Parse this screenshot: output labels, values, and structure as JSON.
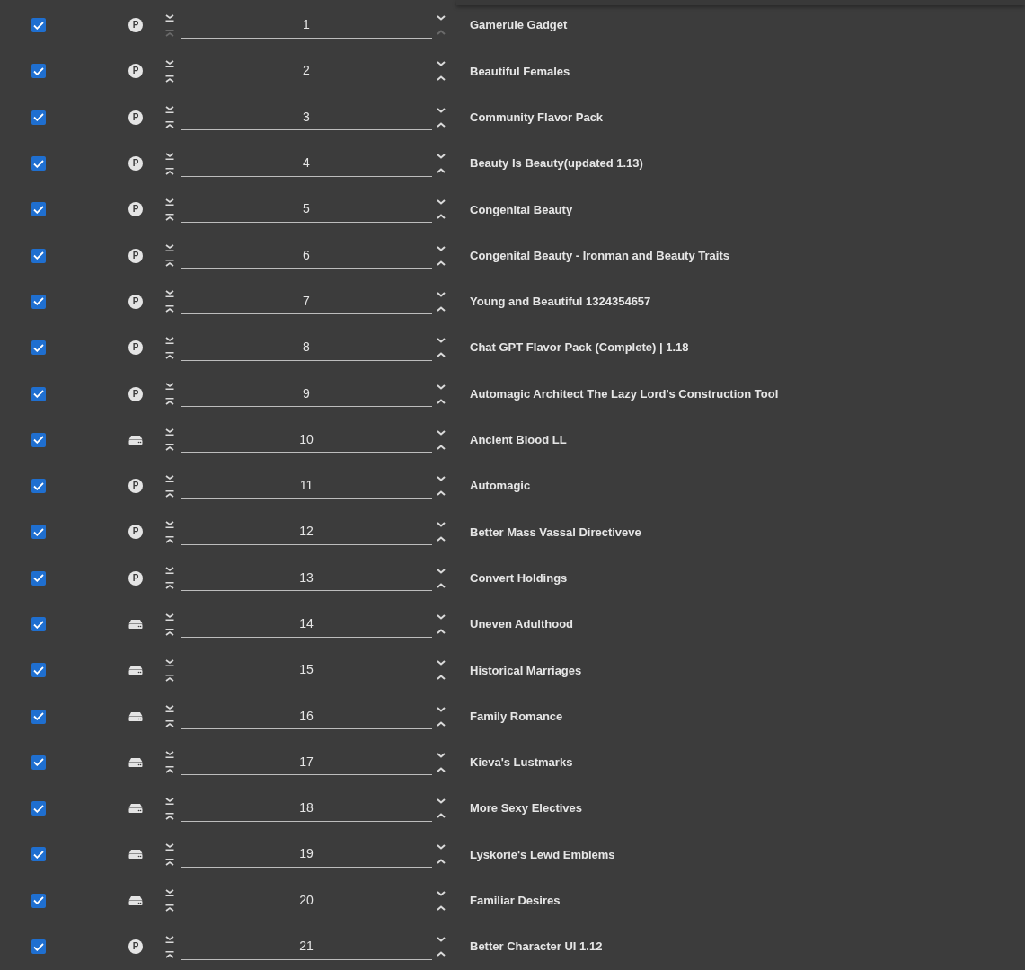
{
  "mods": [
    {
      "checked": true,
      "source": {
        "kind": "letter",
        "letter": "P"
      },
      "top_disabled": true,
      "up_disabled": true,
      "order": "1",
      "name": "Gamerule Gadget"
    },
    {
      "checked": true,
      "source": {
        "kind": "letter",
        "letter": "P"
      },
      "top_disabled": false,
      "up_disabled": false,
      "order": "2",
      "name": "Beautiful Females"
    },
    {
      "checked": true,
      "source": {
        "kind": "letter",
        "letter": "P"
      },
      "top_disabled": false,
      "up_disabled": false,
      "order": "3",
      "name": "Community Flavor Pack"
    },
    {
      "checked": true,
      "source": {
        "kind": "letter",
        "letter": "P"
      },
      "top_disabled": false,
      "up_disabled": false,
      "order": "4",
      "name": "Beauty Is Beauty(updated 1.13)"
    },
    {
      "checked": true,
      "source": {
        "kind": "letter",
        "letter": "P"
      },
      "top_disabled": false,
      "up_disabled": false,
      "order": "5",
      "name": "Congenital Beauty"
    },
    {
      "checked": true,
      "source": {
        "kind": "letter",
        "letter": "P"
      },
      "top_disabled": false,
      "up_disabled": false,
      "order": "6",
      "name": "Congenital Beauty - Ironman and Beauty Traits"
    },
    {
      "checked": true,
      "source": {
        "kind": "letter",
        "letter": "P"
      },
      "top_disabled": false,
      "up_disabled": false,
      "order": "7",
      "name": "Young and Beautiful 1324354657"
    },
    {
      "checked": true,
      "source": {
        "kind": "letter",
        "letter": "P"
      },
      "top_disabled": false,
      "up_disabled": false,
      "order": "8",
      "name": "Chat GPT Flavor Pack (Complete) | 1.18"
    },
    {
      "checked": true,
      "source": {
        "kind": "letter",
        "letter": "P"
      },
      "top_disabled": false,
      "up_disabled": false,
      "order": "9",
      "name": "Automagic Architect The Lazy Lord's Construction Tool"
    },
    {
      "checked": true,
      "source": {
        "kind": "drive"
      },
      "top_disabled": false,
      "up_disabled": false,
      "order": "10",
      "name": "Ancient Blood LL"
    },
    {
      "checked": true,
      "source": {
        "kind": "letter",
        "letter": "P"
      },
      "top_disabled": false,
      "up_disabled": false,
      "order": "11",
      "name": "Automagic"
    },
    {
      "checked": true,
      "source": {
        "kind": "letter",
        "letter": "P"
      },
      "top_disabled": false,
      "up_disabled": false,
      "order": "12",
      "name": "Better Mass Vassal Directiveve"
    },
    {
      "checked": true,
      "source": {
        "kind": "letter",
        "letter": "P"
      },
      "top_disabled": false,
      "up_disabled": false,
      "order": "13",
      "name": "Convert Holdings"
    },
    {
      "checked": true,
      "source": {
        "kind": "drive"
      },
      "top_disabled": false,
      "up_disabled": false,
      "order": "14",
      "name": "Uneven Adulthood"
    },
    {
      "checked": true,
      "source": {
        "kind": "drive"
      },
      "top_disabled": false,
      "up_disabled": false,
      "order": "15",
      "name": "Historical Marriages"
    },
    {
      "checked": true,
      "source": {
        "kind": "drive"
      },
      "top_disabled": false,
      "up_disabled": false,
      "order": "16",
      "name": "Family Romance"
    },
    {
      "checked": true,
      "source": {
        "kind": "drive"
      },
      "top_disabled": false,
      "up_disabled": false,
      "order": "17",
      "name": "Kieva's Lustmarks"
    },
    {
      "checked": true,
      "source": {
        "kind": "drive"
      },
      "top_disabled": false,
      "up_disabled": false,
      "order": "18",
      "name": "More Sexy Electives"
    },
    {
      "checked": true,
      "source": {
        "kind": "drive"
      },
      "top_disabled": false,
      "up_disabled": false,
      "order": "19",
      "name": "Lyskorie's Lewd Emblems"
    },
    {
      "checked": true,
      "source": {
        "kind": "drive"
      },
      "top_disabled": false,
      "up_disabled": false,
      "order": "20",
      "name": "Familiar Desires"
    },
    {
      "checked": true,
      "source": {
        "kind": "letter",
        "letter": "P"
      },
      "top_disabled": false,
      "up_disabled": false,
      "order": "21",
      "name": "Better Character UI 1.12"
    }
  ]
}
